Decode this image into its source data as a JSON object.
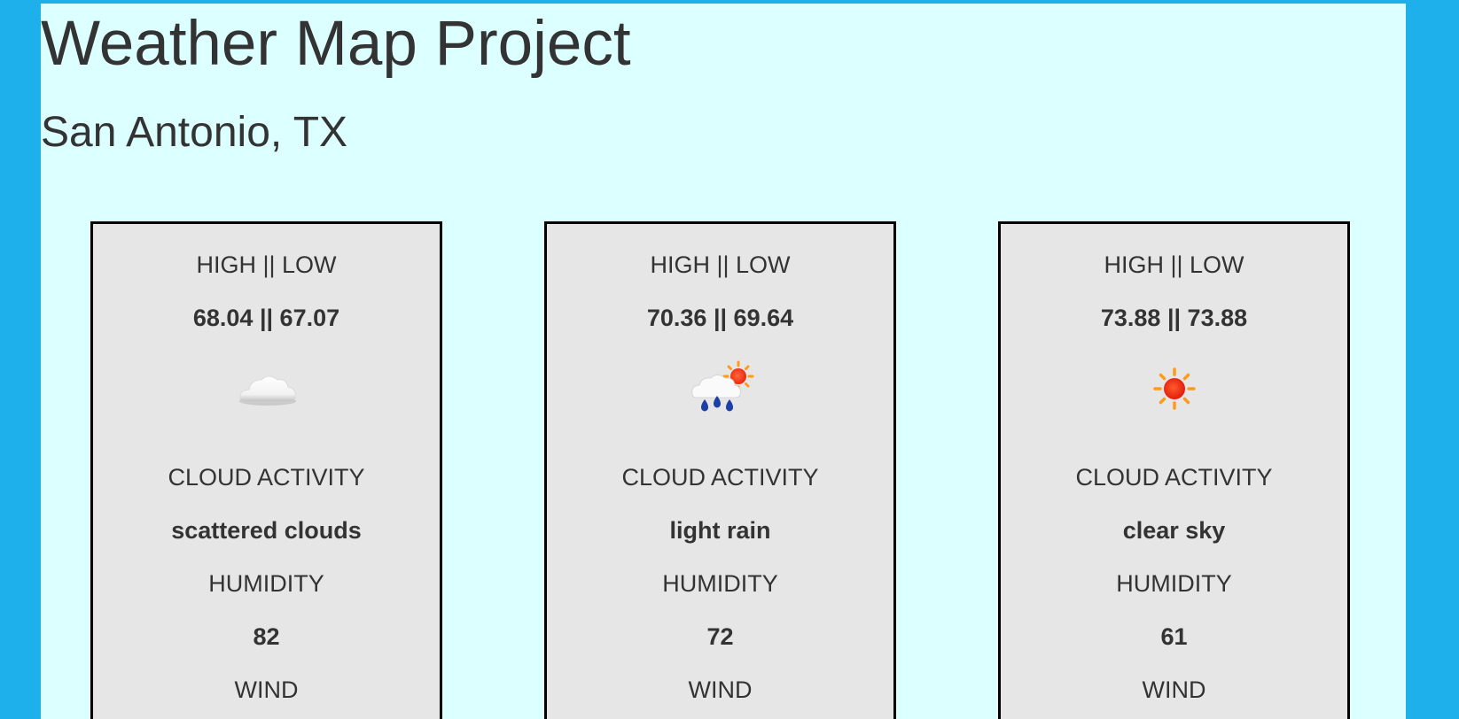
{
  "page": {
    "title": "Weather Map Project",
    "city": "San Antonio, TX"
  },
  "colors": {
    "outer_background": "#1eb0ea",
    "content_background": "#dcffff",
    "card_background": "#e6e6e6",
    "card_border": "#000000",
    "text": "#333333"
  },
  "cards": [
    {
      "high_low_label": "HIGH || LOW",
      "high_low_value": "68.04 || 67.07",
      "icon": "cloud-icon",
      "cloud_label": "CLOUD ACTIVITY",
      "cloud_value": "scattered clouds",
      "humidity_label": "HUMIDITY",
      "humidity_value": "82",
      "wind_label": "WIND"
    },
    {
      "high_low_label": "HIGH || LOW",
      "high_low_value": "70.36 || 69.64",
      "icon": "rain-sun-icon",
      "cloud_label": "CLOUD ACTIVITY",
      "cloud_value": "light rain",
      "humidity_label": "HUMIDITY",
      "humidity_value": "72",
      "wind_label": "WIND"
    },
    {
      "high_low_label": "HIGH || LOW",
      "high_low_value": "73.88 || 73.88",
      "icon": "sun-icon",
      "cloud_label": "CLOUD ACTIVITY",
      "cloud_value": "clear sky",
      "humidity_label": "HUMIDITY",
      "humidity_value": "61",
      "wind_label": "WIND"
    }
  ]
}
